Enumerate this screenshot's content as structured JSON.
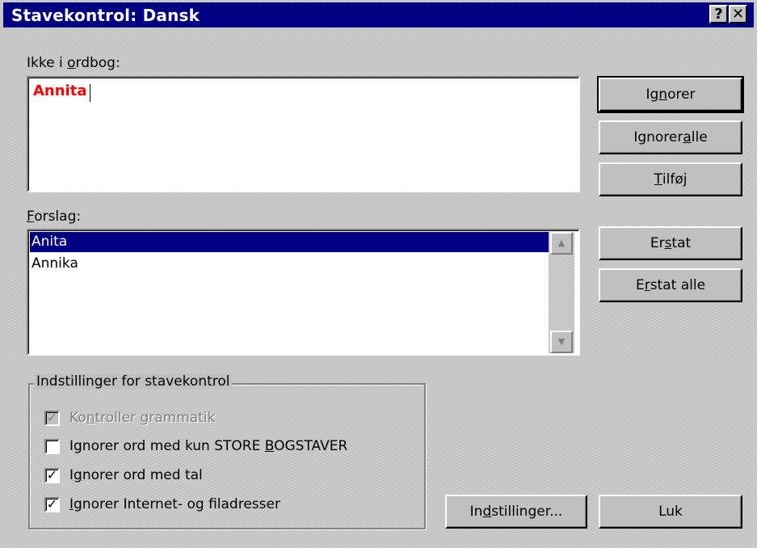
{
  "window": {
    "title": "Stavekontrol: Dansk",
    "help_glyph": "?",
    "close_glyph": "✕"
  },
  "not_in_dictionary": {
    "label_pre": "Ikke i ",
    "label_access": "o",
    "label_post": "rdbog:",
    "word": "Annita"
  },
  "suggestions": {
    "label_access": "F",
    "label_post": "orslag:",
    "items": [
      "Anita",
      "Annika"
    ],
    "selected_index": 0
  },
  "buttons": {
    "ignore": {
      "pre": "Ig",
      "access": "n",
      "post": "orer"
    },
    "ignore_all": {
      "pre": "Ignorer ",
      "access": "a",
      "post": "lle"
    },
    "add": {
      "pre": "",
      "access": "T",
      "post": "ilføj"
    },
    "replace": {
      "pre": "Er",
      "access": "s",
      "post": "tat"
    },
    "replace_all": {
      "pre": "E",
      "access": "r",
      "post": "stat alle"
    },
    "options": {
      "pre": "In",
      "access": "d",
      "post": "stillinger..."
    },
    "close": {
      "label": "Luk"
    }
  },
  "options_group": {
    "legend": "Indstillinger for stavekontrol",
    "check_grammar": {
      "pre": "Ko",
      "access": "n",
      "post": "troller grammatik",
      "checked": true,
      "enabled": false
    },
    "ignore_upper": {
      "pre": "Ignorer ord med kun STORE ",
      "access": "B",
      "post": "OGSTAVER",
      "checked": false
    },
    "ignore_numbers": {
      "pre": "I",
      "access": "g",
      "post": "norer ord med tal",
      "checked": true
    },
    "ignore_internet": {
      "pre": "",
      "access": "I",
      "post": "gnorer Internet- og filadresser",
      "checked": true
    }
  },
  "icons": {
    "scroll_up": "▲",
    "scroll_down": "▼",
    "check_mark": "✓"
  },
  "colors": {
    "title_bar": "#000080",
    "unknown_word": "#ff0000",
    "selection": "#000080",
    "face": "#c0c0c0"
  }
}
